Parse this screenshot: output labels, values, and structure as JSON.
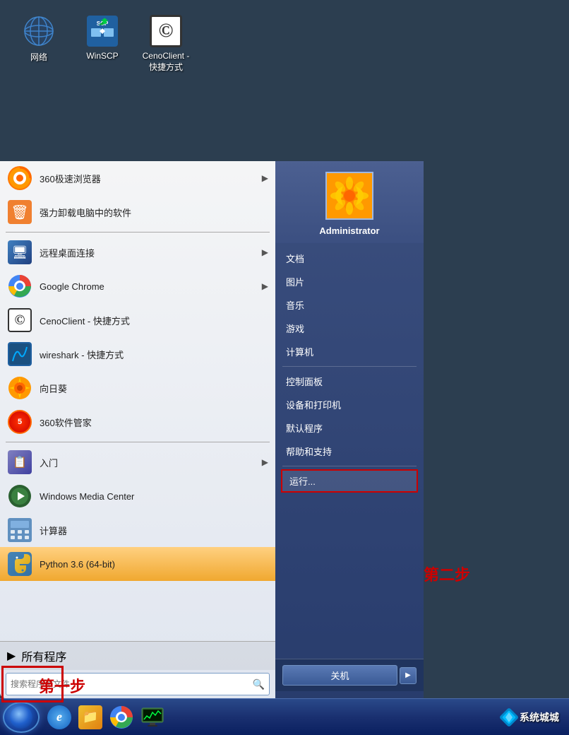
{
  "desktop": {
    "icons": [
      {
        "id": "network",
        "label": "网络",
        "type": "network"
      },
      {
        "id": "winscp",
        "label": "WinSCP",
        "type": "winscp"
      },
      {
        "id": "cenoclient-shortcut",
        "label": "CenoClient -\n快捷方式",
        "type": "cenoclient"
      }
    ]
  },
  "startmenu": {
    "left": {
      "items": [
        {
          "id": "360browser",
          "label": "360极速浏览器",
          "hasArrow": true,
          "type": "360"
        },
        {
          "id": "uninstall",
          "label": "强力卸载电脑中的软件",
          "hasArrow": false,
          "type": "uninstall"
        },
        {
          "id": "remote",
          "label": "远程桌面连接",
          "hasArrow": true,
          "type": "remote"
        },
        {
          "id": "chrome",
          "label": "Google Chrome",
          "hasArrow": true,
          "type": "chrome"
        },
        {
          "id": "cenoclient",
          "label": "CenoClient - 快捷方式",
          "hasArrow": false,
          "type": "cenoclient"
        },
        {
          "id": "wireshark",
          "label": "wireshark - 快捷方式",
          "hasArrow": false,
          "type": "wireshark"
        },
        {
          "id": "sunflower",
          "label": "向日葵",
          "hasArrow": false,
          "type": "sunflower"
        },
        {
          "id": "360mgr",
          "label": "360软件管家",
          "hasArrow": false,
          "type": "360mgr"
        },
        {
          "id": "getstarted",
          "label": "入门",
          "hasArrow": true,
          "type": "start"
        },
        {
          "id": "wmc",
          "label": "Windows Media Center",
          "hasArrow": false,
          "type": "wmc"
        },
        {
          "id": "calc",
          "label": "计算器",
          "hasArrow": false,
          "type": "calc"
        },
        {
          "id": "python",
          "label": "Python 3.6 (64-bit)",
          "hasArrow": false,
          "type": "python",
          "highlighted": true
        }
      ],
      "allPrograms": "所有程序",
      "searchPlaceholder": "搜索程序和文件"
    },
    "right": {
      "userName": "Administrator",
      "menuItems": [
        {
          "id": "documents",
          "label": "文档"
        },
        {
          "id": "pictures",
          "label": "图片"
        },
        {
          "id": "music",
          "label": "音乐"
        },
        {
          "id": "games",
          "label": "游戏"
        },
        {
          "id": "computer",
          "label": "计算机"
        },
        {
          "id": "controlpanel",
          "label": "控制面板"
        },
        {
          "id": "devices",
          "label": "设备和打印机"
        },
        {
          "id": "defaultprograms",
          "label": "默认程序"
        },
        {
          "id": "help",
          "label": "帮助和支持"
        },
        {
          "id": "run",
          "label": "运行...",
          "isRun": true
        }
      ],
      "shutdownLabel": "关机"
    }
  },
  "taskbar": {
    "icons": [
      {
        "id": "ie",
        "label": "Internet Explorer",
        "type": "ie"
      },
      {
        "id": "explorer",
        "label": "Windows Explorer",
        "type": "explorer"
      },
      {
        "id": "chrome-task",
        "label": "Google Chrome",
        "type": "chrome"
      },
      {
        "id": "monitor",
        "label": "Monitor",
        "type": "monitor"
      }
    ],
    "systray": "系统城"
  },
  "annotations": {
    "step1": "第一步",
    "step2": "第二步"
  }
}
